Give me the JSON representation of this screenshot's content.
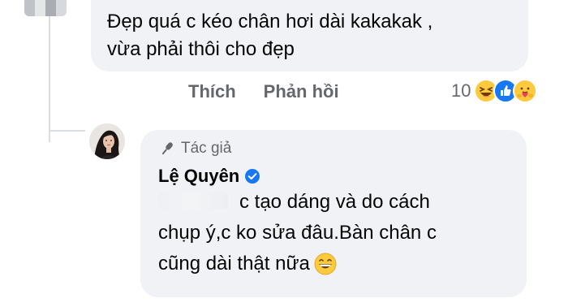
{
  "comment": {
    "line1": "Đẹp quá c kéo chân hơi dài kakakak ,",
    "line2": "vừa phải thôi cho đẹp"
  },
  "actions": {
    "like_label": "Thích",
    "reply_label": "Phản hồi"
  },
  "reactions": {
    "count": "10",
    "icons": [
      "haha-emoji-icon",
      "like-emoji-icon",
      "care-emoji-icon"
    ]
  },
  "reply": {
    "badge": "Tác giả",
    "author": "Lệ Quyên",
    "line1": "c tạo dáng và do cách",
    "line2": "chụp ý,c ko sửa đâu.Bàn chân c",
    "line3": "cũng dài thật nữa"
  },
  "colors": {
    "bubble": "#f0f2f5",
    "muted_text": "#65676b",
    "verified_blue": "#1877f2",
    "reaction_yellow": "#fcca3c"
  }
}
